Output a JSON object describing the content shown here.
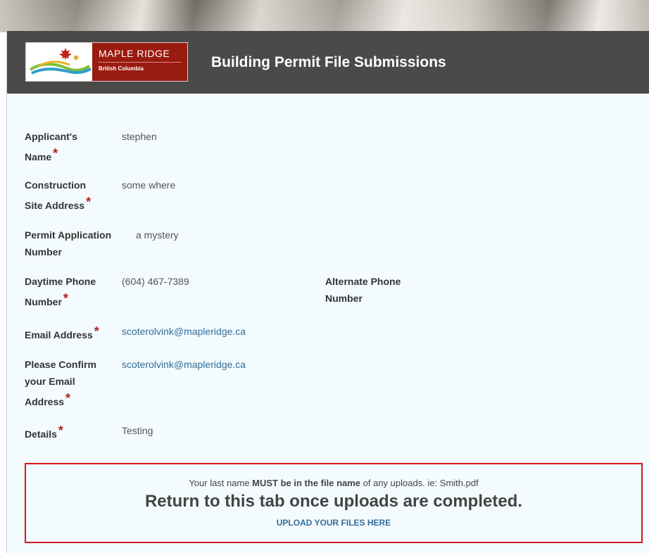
{
  "header": {
    "logo": {
      "name": "MAPLE RIDGE",
      "sub": "British Columbia"
    },
    "title": "Building Permit File Submissions"
  },
  "form": {
    "applicant_name": {
      "label_line1": "Applicant's",
      "label_line2": "Name",
      "required": "*",
      "value": "stephen"
    },
    "site_address": {
      "label_line1": "Construction",
      "label_line2": "Site Address",
      "required": "*",
      "value": "some where"
    },
    "permit_number": {
      "label_line1": "Permit Application",
      "label_line2": "Number",
      "value": "a mystery"
    },
    "daytime_phone": {
      "label_line1": "Daytime Phone",
      "label_line2": "Number",
      "required": "*",
      "value": "(604) 467-7389"
    },
    "alternate_phone": {
      "label_line1": "Alternate Phone",
      "label_line2": "Number",
      "value": ""
    },
    "email": {
      "label": "Email Address",
      "required": "*",
      "value": "scoterolvink@mapleridge.ca"
    },
    "confirm_email": {
      "label_line1": "Please Confirm",
      "label_line2": "your Email",
      "label_line3": "Address",
      "required": "*",
      "value": "scoterolvink@mapleridge.ca"
    },
    "details": {
      "label": "Details",
      "required": "*",
      "value": "Testing"
    }
  },
  "notice": {
    "prefix": "Your last name ",
    "bold": "MUST be in the file name",
    "suffix": " of any uploads. ie:  Smith.pdf",
    "headline": "Return to this tab once uploads are completed.",
    "link": "UPLOAD YOUR FILES HERE"
  },
  "colors": {
    "header_bg": "#4b4a48",
    "page_bg": "#f4fbfe",
    "required": "#b21f24",
    "link": "#2f6d9a",
    "notice_border": "#d3191e",
    "logo_red": "#9a1b10"
  }
}
